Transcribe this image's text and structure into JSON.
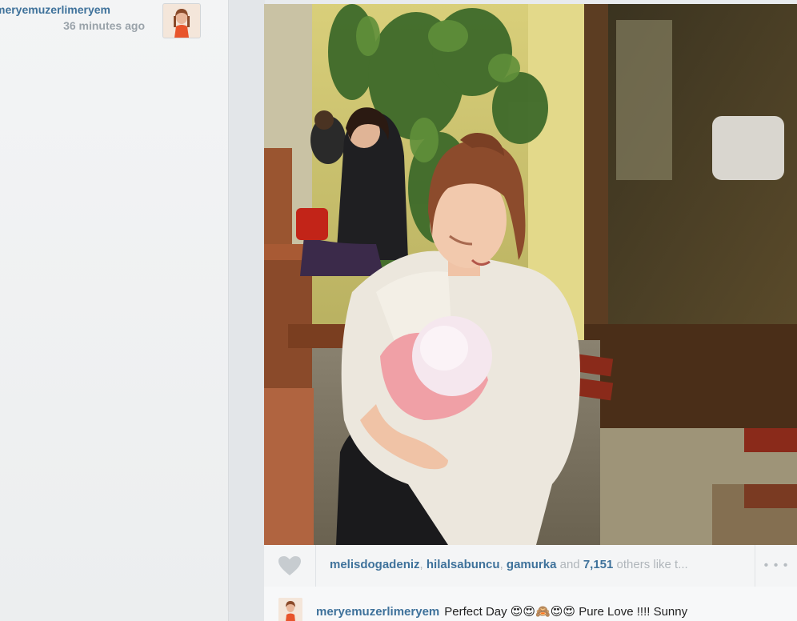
{
  "post": {
    "owner_username": "meryemuzerlimeryem",
    "timestamp": "36 minutes ago"
  },
  "photo": {
    "icon": "photo-woman-with-baby"
  },
  "likes": {
    "likers": [
      "melisdogadeniz",
      "hilalsabuncu",
      "gamurka"
    ],
    "sep1": ", ",
    "sep2": ", ",
    "and_text": " and ",
    "count": "7,151",
    "suffix": " others like t..."
  },
  "more_label": "• • •",
  "caption": {
    "author": "meryemuzerlimeryem",
    "text": "Perfect Day 😍😍🙈😍😍 Pure Love !!!! Sunny"
  },
  "colors": {
    "link": "#3f729b",
    "muted": "#b0b6bb"
  }
}
